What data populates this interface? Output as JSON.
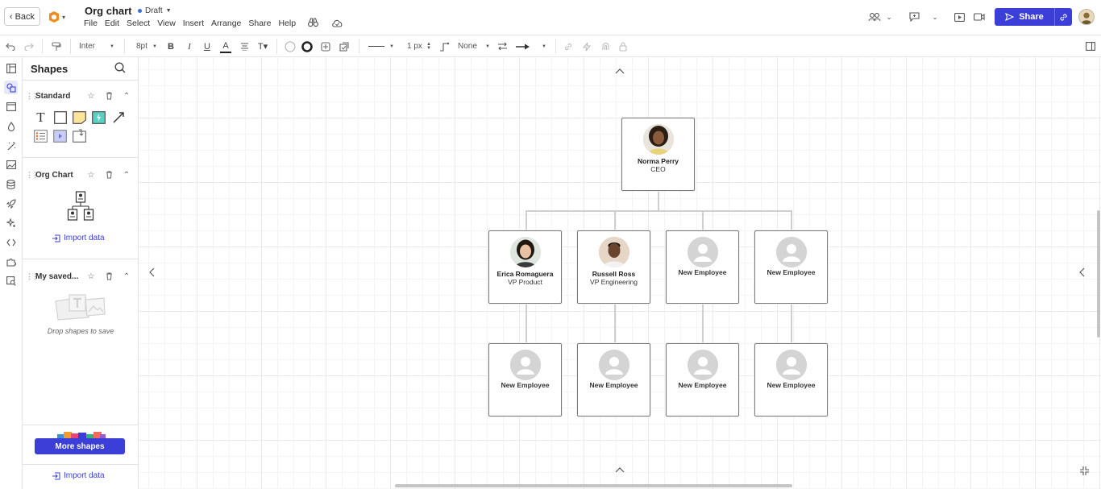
{
  "header": {
    "back_label": "Back",
    "doc_title": "Org chart",
    "status": "Draft",
    "menu": [
      "File",
      "Edit",
      "Select",
      "View",
      "Insert",
      "Arrange",
      "Share",
      "Help"
    ],
    "share_label": "Share"
  },
  "toolbar": {
    "font": "Inter",
    "font_size": "8pt",
    "line_width": "1 px",
    "arrow_start": "None"
  },
  "panel": {
    "title": "Shapes",
    "sections": [
      {
        "label": "Standard"
      },
      {
        "label": "Org Chart",
        "import": "Import data"
      },
      {
        "label": "My saved...",
        "drop_text": "Drop shapes to save"
      }
    ],
    "more_shapes": "More shapes",
    "import_bottom": "Import data"
  },
  "org": {
    "ceo": {
      "name": "Norma Perry",
      "role": "CEO"
    },
    "level2": [
      {
        "name": "Erica Romaguera",
        "role": "VP Product"
      },
      {
        "name": "Russell Ross",
        "role": "VP Engineering"
      },
      {
        "name": "New Employee"
      },
      {
        "name": "New Employee"
      }
    ],
    "level3": [
      {
        "name": "New Employee"
      },
      {
        "name": "New Employee"
      },
      {
        "name": "New Employee"
      },
      {
        "name": "New Employee"
      }
    ]
  },
  "colors": {
    "accent": "#3b3fd8",
    "draft_dot": "#3a6fd8",
    "card_border": "#7a7a7a",
    "connector": "#cfcfcf"
  }
}
